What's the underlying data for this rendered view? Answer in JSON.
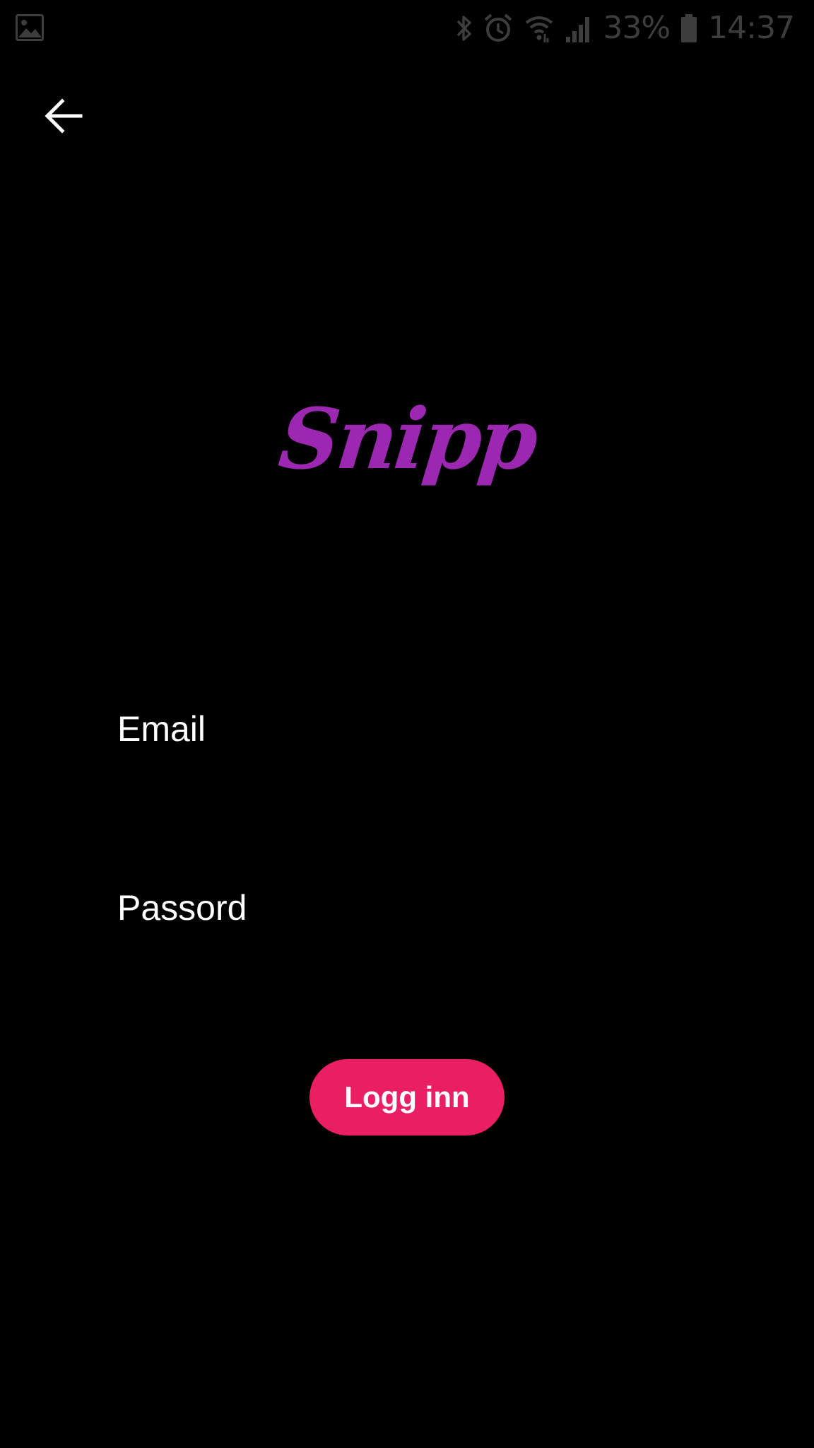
{
  "status_bar": {
    "left_icon": "image-notification-icon",
    "icons": [
      "bluetooth-icon",
      "alarm-icon",
      "wifi-icon",
      "cellular-signal-icon"
    ],
    "battery_percent": "33%",
    "battery_icon": "battery-icon",
    "time": "14:37",
    "icon_color": "#3d3d3d"
  },
  "navigation": {
    "back_icon": "arrow-left-icon"
  },
  "logo": {
    "text": "Snipp",
    "color": "#9c27b0"
  },
  "form": {
    "email": {
      "label": "Email",
      "value": ""
    },
    "password": {
      "label": "Passord",
      "value": ""
    }
  },
  "login_button": {
    "label": "Logg inn",
    "color": "#e91e63"
  },
  "colors": {
    "background": "#000000",
    "text": "#ffffff"
  }
}
